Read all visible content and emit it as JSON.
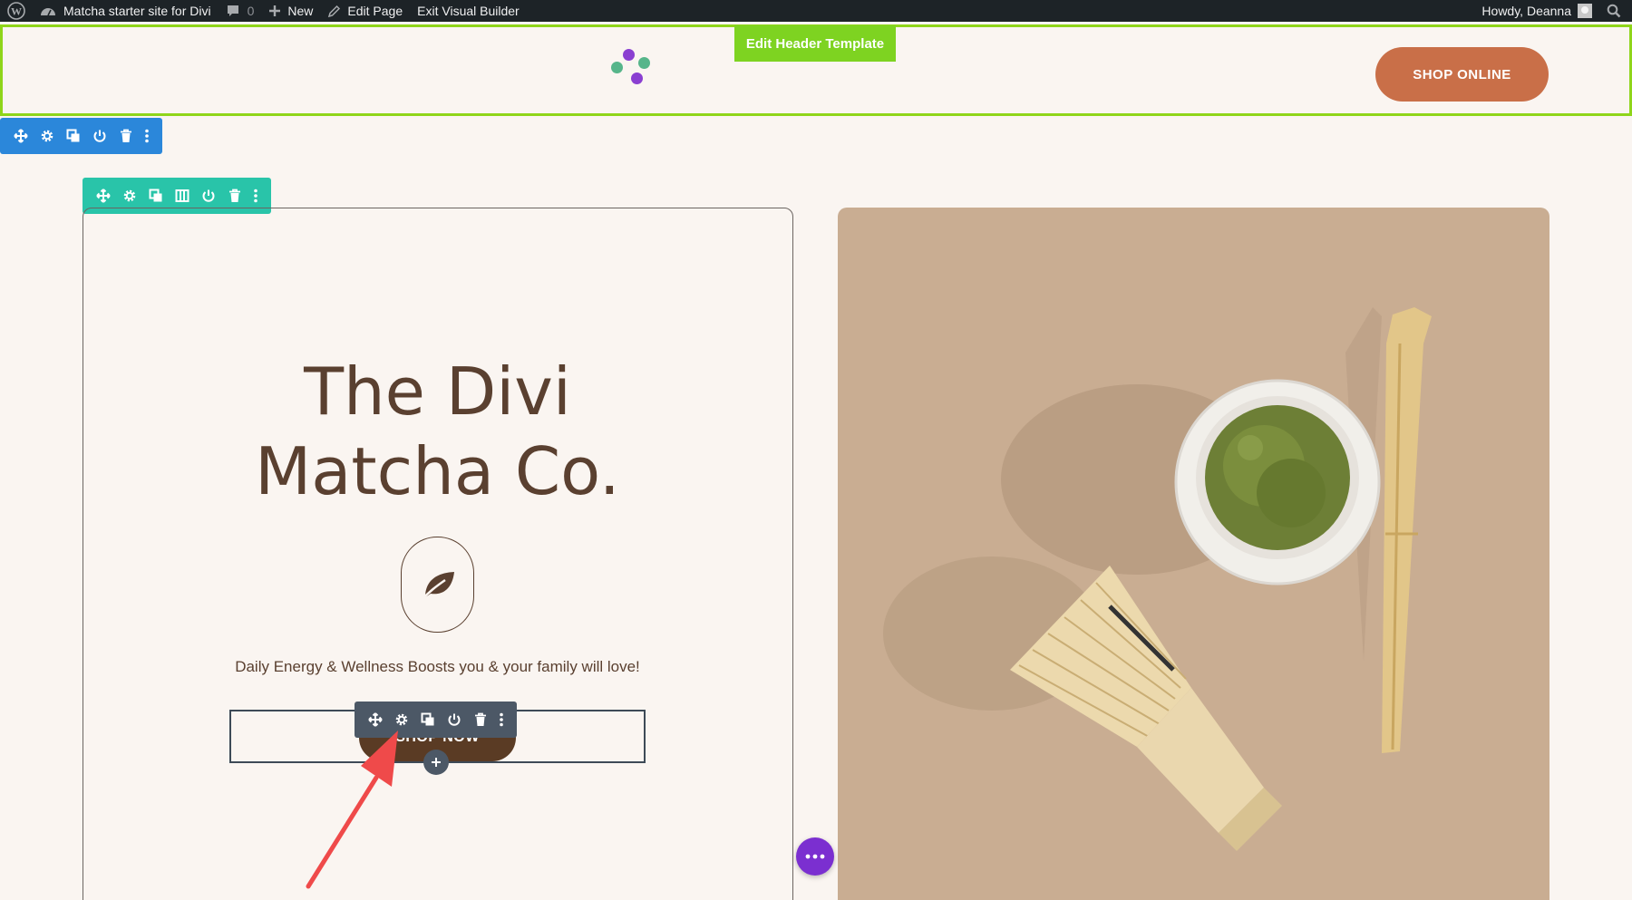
{
  "adminbar": {
    "site_name": "Matcha starter site for Divi",
    "comments_count": "0",
    "new_label": "New",
    "edit_page_label": "Edit Page",
    "exit_builder_label": "Exit Visual Builder",
    "greeting": "Howdy, Deanna"
  },
  "header": {
    "edit_template_label": "Edit Header Template",
    "cta_label": "SHOP ONLINE"
  },
  "hero": {
    "title_line1": "The Divi",
    "title_line2": "Matcha Co.",
    "tagline": "Daily Energy & Wellness Boosts you & your family will love!",
    "button_label": "SHOP NOW"
  },
  "icons": {
    "section_toolbar": [
      "move-icon",
      "gear-icon",
      "duplicate-icon",
      "power-icon",
      "trash-icon",
      "more-vertical-icon"
    ],
    "row_toolbar": [
      "move-icon",
      "gear-icon",
      "duplicate-icon",
      "columns-icon",
      "power-icon",
      "trash-icon",
      "more-vertical-icon"
    ],
    "module_toolbar": [
      "move-icon",
      "gear-icon",
      "duplicate-icon",
      "power-icon",
      "trash-icon",
      "more-vertical-icon"
    ]
  },
  "colors": {
    "section_toolbar": "#2b87da",
    "row_toolbar": "#29c4a9",
    "module_toolbar": "#4c5866",
    "header_outline": "#8fd51a",
    "shop_online_bg": "#c96f48",
    "brand_brown": "#5a4030",
    "fab": "#7b2fd0",
    "annotation_arrow": "#ef4a4a"
  }
}
